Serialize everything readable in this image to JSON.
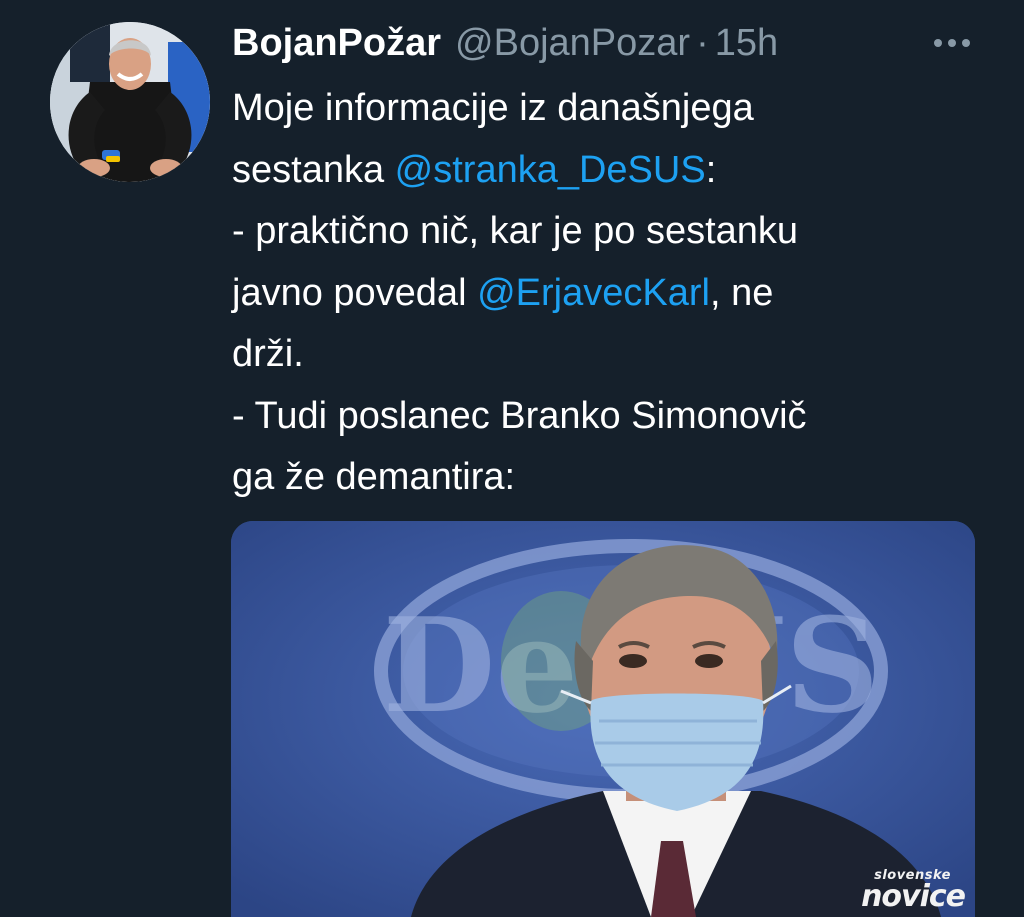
{
  "tweet": {
    "author": {
      "display_name": "BojanPožar",
      "handle": "@BojanPozar",
      "separator": "·",
      "time": "15h"
    },
    "text_lines": [
      {
        "pre": "Moje informacije iz današnjega",
        "mention": "",
        "post": ""
      },
      {
        "pre": "sestanka ",
        "mention": "@stranka_DeSUS",
        "post": ":"
      },
      {
        "pre": "- praktično nič, kar je po sestanku",
        "mention": "",
        "post": ""
      },
      {
        "pre": "javno povedal ",
        "mention": "@ErjavecKarl",
        "post": ", ne"
      },
      {
        "pre": "drži.",
        "mention": "",
        "post": ""
      },
      {
        "pre": "- Tudi poslanec Branko Simonovič",
        "mention": "",
        "post": ""
      },
      {
        "pre": "ga že demantira:",
        "mention": "",
        "post": ""
      }
    ],
    "media": {
      "logo_text": "DeSUS",
      "watermark_small": "slovenske",
      "watermark_big": "novice"
    },
    "icons": {
      "avatar": "profile-photo",
      "more": "more-options-icon"
    },
    "colors": {
      "background": "#15202b",
      "mention": "#1da1f2",
      "secondary_text": "#8899a6"
    }
  }
}
